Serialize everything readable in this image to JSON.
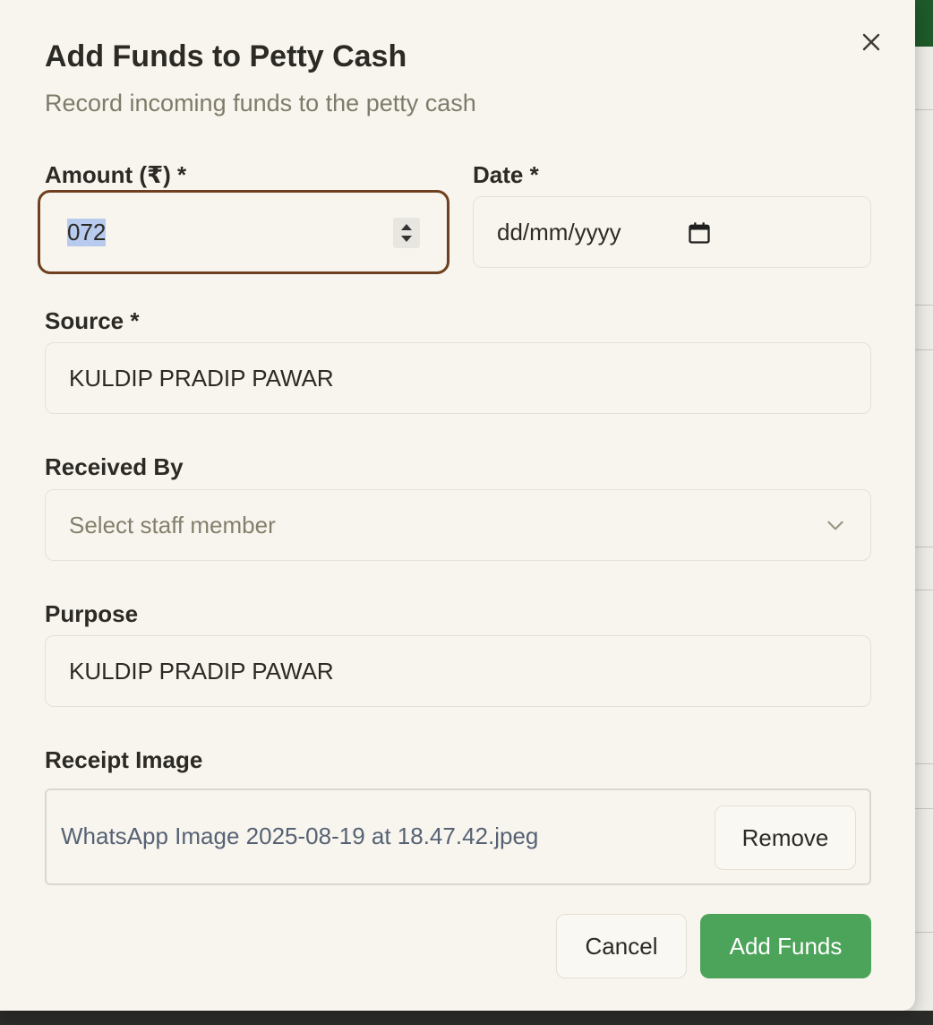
{
  "dialog": {
    "title": "Add Funds to Petty Cash",
    "subtitle": "Record incoming funds to the petty cash",
    "close_icon": "close-icon"
  },
  "form": {
    "amount": {
      "label": "Amount (₹) *",
      "value": "072"
    },
    "date": {
      "label": "Date *",
      "placeholder": "dd/mm/yyyy",
      "icon": "calendar-icon"
    },
    "source": {
      "label": "Source *",
      "value": "KULDIP PRADIP PAWAR"
    },
    "received_by": {
      "label": "Received By",
      "placeholder": "Select staff member",
      "icon": "chevron-down-icon"
    },
    "purpose": {
      "label": "Purpose",
      "value": "KULDIP PRADIP PAWAR"
    },
    "receipt": {
      "label": "Receipt Image",
      "file_name": "WhatsApp Image 2025-08-19 at 18.47.42.jpeg",
      "remove_label": "Remove"
    }
  },
  "actions": {
    "cancel_label": "Cancel",
    "submit_label": "Add Funds"
  },
  "colors": {
    "dialog_bg": "#f8f5ee",
    "focus_border": "#6e401f",
    "primary": "#4ca35a",
    "text": "#2c2a25",
    "muted": "#7f7b6a"
  }
}
